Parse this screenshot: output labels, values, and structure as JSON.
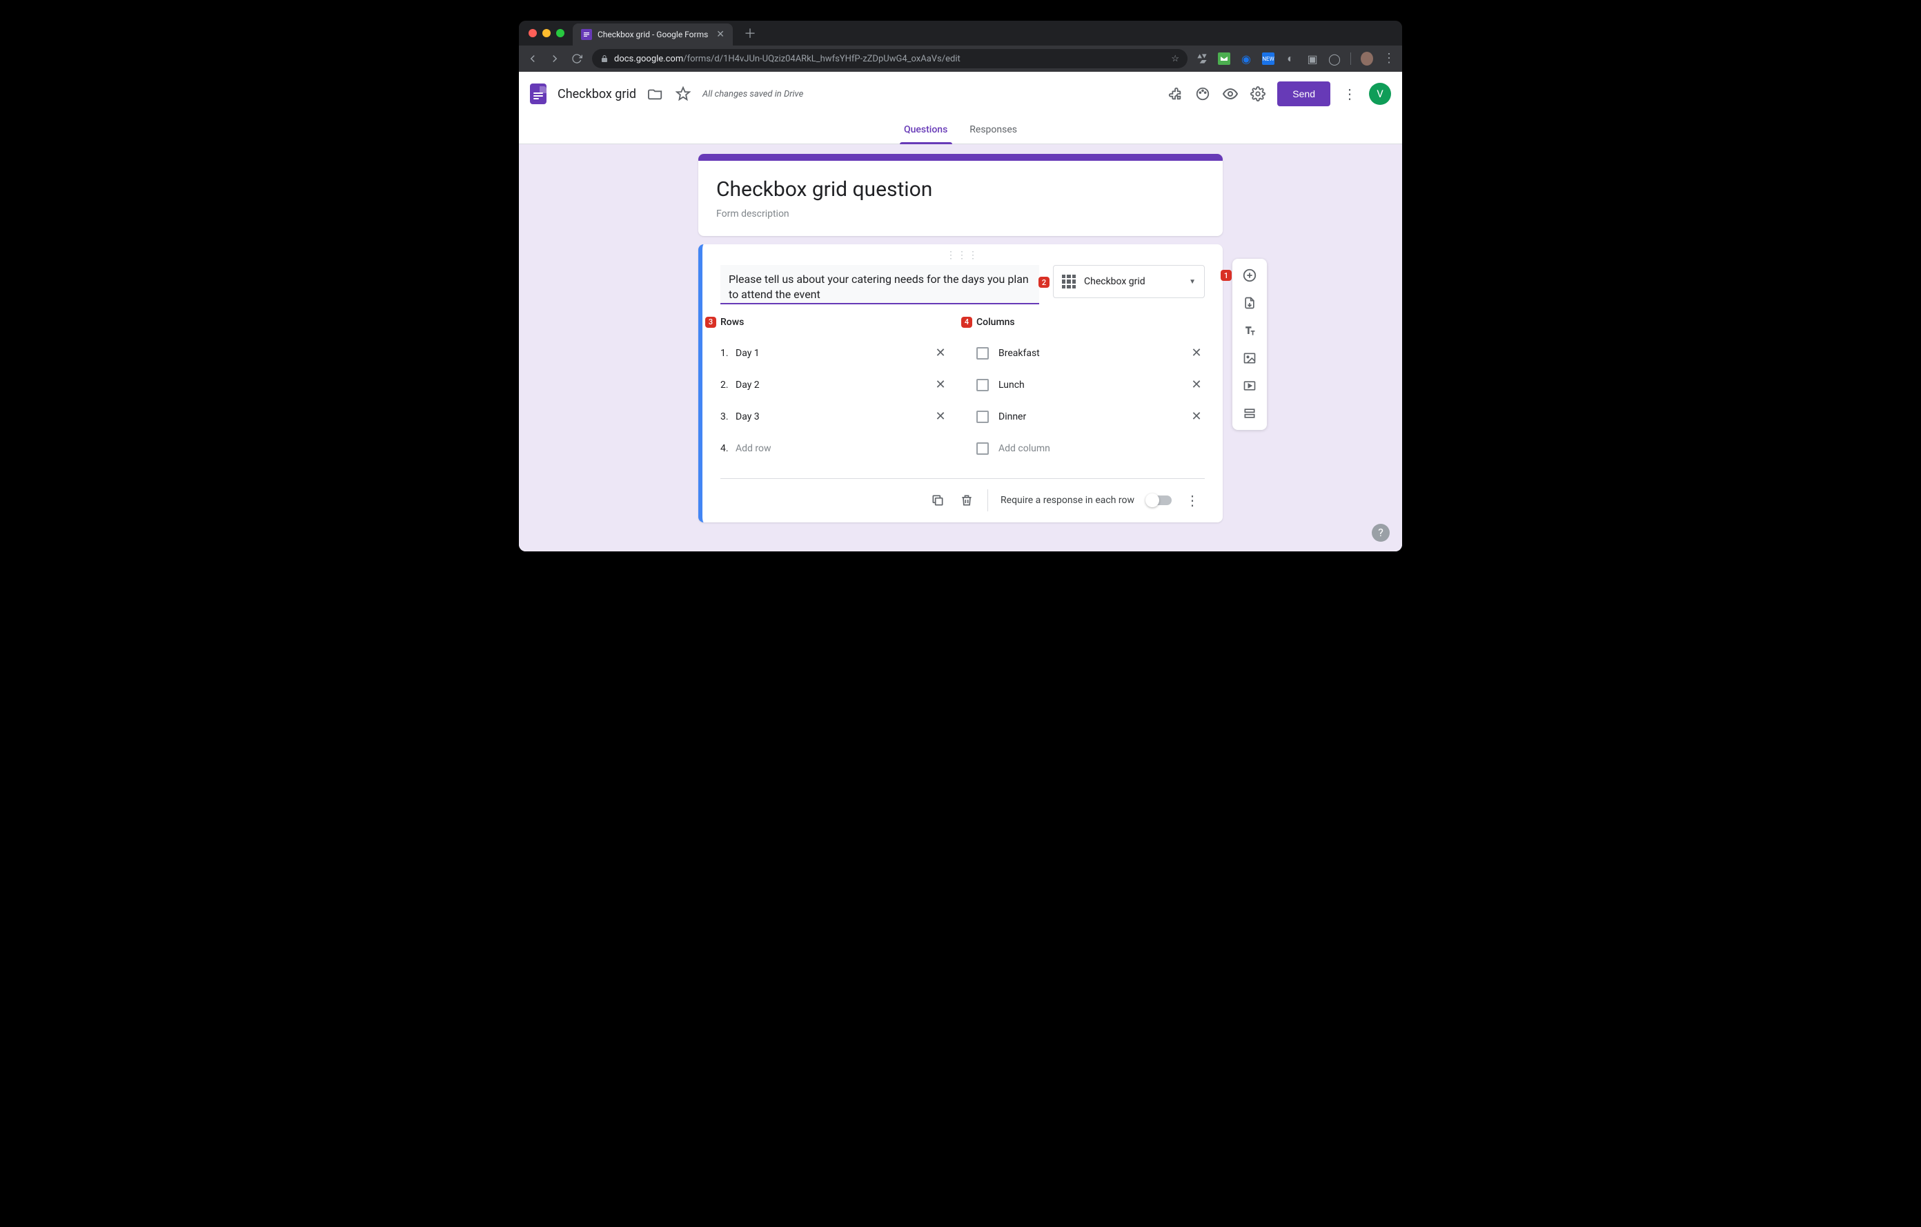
{
  "browser": {
    "tab_title": "Checkbox grid - Google Forms",
    "url_domain": "docs.google.com",
    "url_path": "/forms/d/1H4vJUn-UQziz04ARkL_hwfsYHfP-zZDpUwG4_oxAaVs/edit"
  },
  "header": {
    "title": "Checkbox grid",
    "save_status": "All changes saved in Drive",
    "send_label": "Send",
    "avatar_letter": "V"
  },
  "tabs": {
    "questions": "Questions",
    "responses": "Responses"
  },
  "form": {
    "title": "Checkbox grid question",
    "description_placeholder": "Form description"
  },
  "question": {
    "text": "Please tell us about your catering needs for the days you plan to attend the event",
    "type_label": "Checkbox grid",
    "rows_label": "Rows",
    "columns_label": "Columns",
    "rows": [
      "Day 1",
      "Day 2",
      "Day 3"
    ],
    "add_row_placeholder": "Add row",
    "add_row_number": "4.",
    "columns": [
      "Breakfast",
      "Lunch",
      "Dinner"
    ],
    "add_column_placeholder": "Add column",
    "require_label": "Require a response in each row"
  },
  "badges": {
    "b1": "1",
    "b2": "2",
    "b3": "3",
    "b4": "4"
  },
  "help": "?"
}
